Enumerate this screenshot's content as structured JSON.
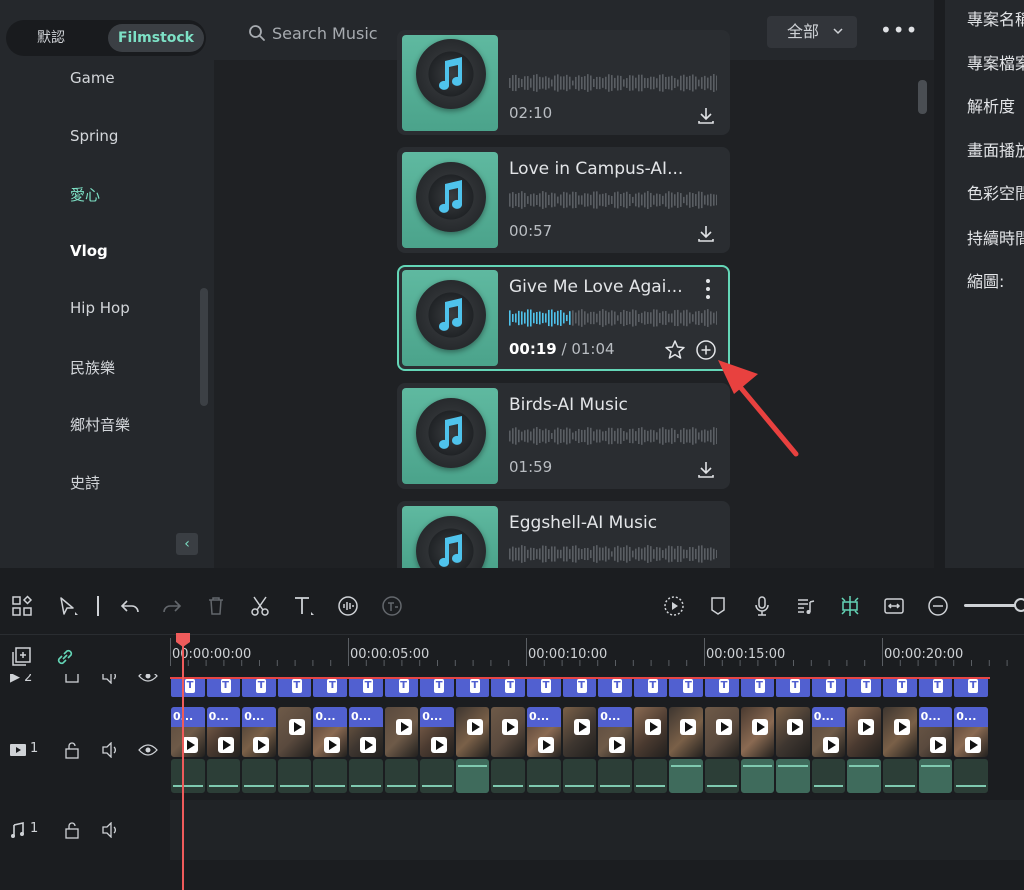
{
  "tabs": {
    "default_label": "默認",
    "filmstock_label": "Filmstock"
  },
  "categories": [
    {
      "label": "Game",
      "color": "#d3d6da"
    },
    {
      "label": "Spring",
      "color": "#d3d6da"
    },
    {
      "label": "愛心",
      "color": "#7de0c5"
    },
    {
      "label": "Vlog",
      "color": "#ffffff"
    },
    {
      "label": "Hip Hop",
      "color": "#d3d6da"
    },
    {
      "label": "民族樂",
      "color": "#d3d6da"
    },
    {
      "label": "鄉村音樂",
      "color": "#d3d6da"
    },
    {
      "label": "史詩",
      "color": "#d3d6da"
    }
  ],
  "search": {
    "placeholder": "Search Music"
  },
  "filter": {
    "value": "全部"
  },
  "music_list": [
    {
      "title": "",
      "duration": "02:10"
    },
    {
      "title": "Love in Campus-AI...",
      "duration": "00:57"
    },
    {
      "title": "Give Me Love Agai...",
      "current_time": "00:19",
      "separator": " / ",
      "duration": "01:04",
      "progress": 0.3
    },
    {
      "title": "Birds-AI Music",
      "duration": "01:59"
    },
    {
      "title": "Eggshell-AI Music",
      "duration": ""
    }
  ],
  "properties": {
    "labels": [
      "專案名稱",
      "專案檔案",
      "解析度",
      "畫面播放",
      "色彩空間",
      "持續時間",
      "縮圖:"
    ]
  },
  "ruler": [
    "00:00:00:00",
    "00:00:05:00",
    "00:00:10:00",
    "00:00:15:00",
    "00:00:20:00"
  ],
  "tracks": {
    "title_track": "2",
    "video_track": "1",
    "music_track": "1"
  },
  "clips": {
    "title_clip_label": "T",
    "video_clip_label": "0..."
  },
  "colors": {
    "accent": "#64d6b7",
    "playhead": "#ef5b5b",
    "title_clip": "#5160d0",
    "audio_clip": "#2c3e37"
  }
}
